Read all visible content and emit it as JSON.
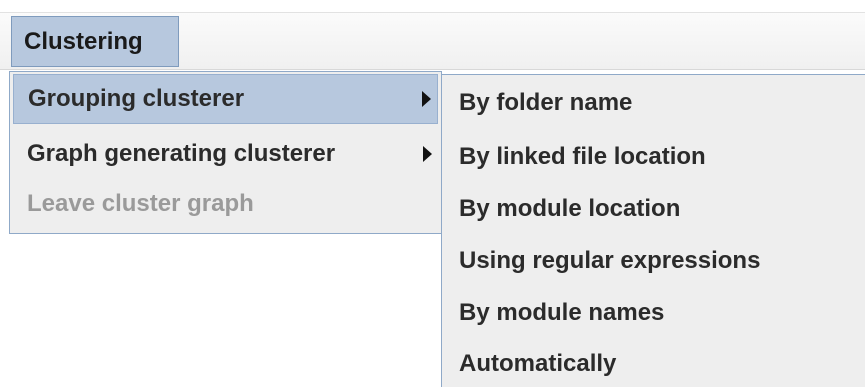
{
  "menubar": {
    "menu_label": "Clustering"
  },
  "dropdown": {
    "items": [
      {
        "label": "Grouping clusterer",
        "has_submenu": true,
        "state": "selected"
      },
      {
        "label": "Graph generating clusterer",
        "has_submenu": true,
        "state": "normal"
      },
      {
        "label": "Leave cluster graph",
        "has_submenu": false,
        "state": "disabled"
      }
    ]
  },
  "submenu": {
    "items": [
      {
        "label": "By folder name"
      },
      {
        "label": "By linked file location"
      },
      {
        "label": "By module location"
      },
      {
        "label": "Using regular expressions"
      },
      {
        "label": "By module names"
      },
      {
        "label": "Automatically"
      }
    ]
  },
  "colors": {
    "selection_background": "#b7c8de",
    "selection_border": "#7f9bbd",
    "menu_background": "#eeeeee",
    "disabled_text": "#9a9a9a",
    "text": "#2b2b2b"
  },
  "icons": {
    "submenu_arrow": "right-triangle-arrow"
  }
}
